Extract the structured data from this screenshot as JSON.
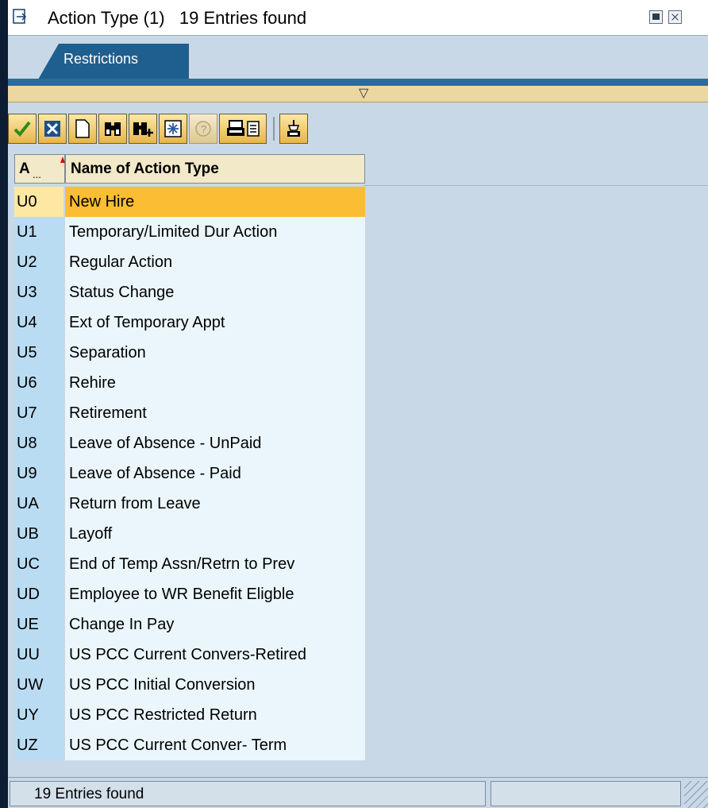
{
  "window": {
    "title": "Action Type (1)",
    "title_count": "19 Entries found",
    "icons": {
      "title": "popup-icon",
      "minimize": "minimize-icon",
      "close": "close-icon"
    }
  },
  "tabs": [
    {
      "label": "Restrictions",
      "active": true
    }
  ],
  "toolbar": {
    "buttons": [
      {
        "name": "continue",
        "icon": "check-icon",
        "color": "#2e8b1e"
      },
      {
        "name": "cancel",
        "icon": "cancel-icon",
        "color": "#1c4f91"
      },
      {
        "name": "new-search",
        "icon": "page-icon"
      },
      {
        "name": "find",
        "icon": "binoculars-icon"
      },
      {
        "name": "find-next",
        "icon": "binoculars-plus-icon"
      },
      {
        "name": "new-entry",
        "icon": "sparkle-icon"
      },
      {
        "name": "info",
        "icon": "info-icon",
        "disabled": true
      },
      {
        "name": "print",
        "icon": "printer-icon"
      },
      {
        "name": "save",
        "icon": "save-list-icon"
      }
    ]
  },
  "table": {
    "columns": [
      {
        "label": "A",
        "abbrev": "..."
      },
      {
        "label": "Name of Action Type"
      }
    ],
    "sort_column": 0,
    "selected_row": 0,
    "rows": [
      {
        "key": "U0",
        "name": "New Hire"
      },
      {
        "key": "U1",
        "name": "Temporary/Limited Dur Action"
      },
      {
        "key": "U2",
        "name": "Regular Action"
      },
      {
        "key": "U3",
        "name": "Status Change"
      },
      {
        "key": "U4",
        "name": "Ext of Temporary Appt"
      },
      {
        "key": "U5",
        "name": "Separation"
      },
      {
        "key": "U6",
        "name": "Rehire"
      },
      {
        "key": "U7",
        "name": "Retirement"
      },
      {
        "key": "U8",
        "name": "Leave of Absence - UnPaid"
      },
      {
        "key": "U9",
        "name": "Leave of Absence - Paid"
      },
      {
        "key": "UA",
        "name": "Return from Leave"
      },
      {
        "key": "UB",
        "name": "Layoff"
      },
      {
        "key": "UC",
        "name": "End of Temp Assn/Retrn to Prev"
      },
      {
        "key": "UD",
        "name": "Employee to WR Benefit Eligble"
      },
      {
        "key": "UE",
        "name": "Change In Pay"
      },
      {
        "key": "UU",
        "name": "US PCC Current Convers-Retired"
      },
      {
        "key": "UW",
        "name": "US PCC Initial Conversion"
      },
      {
        "key": "UY",
        "name": "US PCC Restricted Return"
      },
      {
        "key": "UZ",
        "name": "US PCC Current Conver- Term"
      }
    ]
  },
  "statusbar": {
    "text": "19 Entries found"
  },
  "colors": {
    "selected_row": "#fbbd33",
    "key_column": "#b9dcf3",
    "name_column": "#eaf6fb",
    "tab_active": "#1f5f8f",
    "collapse_bar": "#ecd7a1"
  }
}
